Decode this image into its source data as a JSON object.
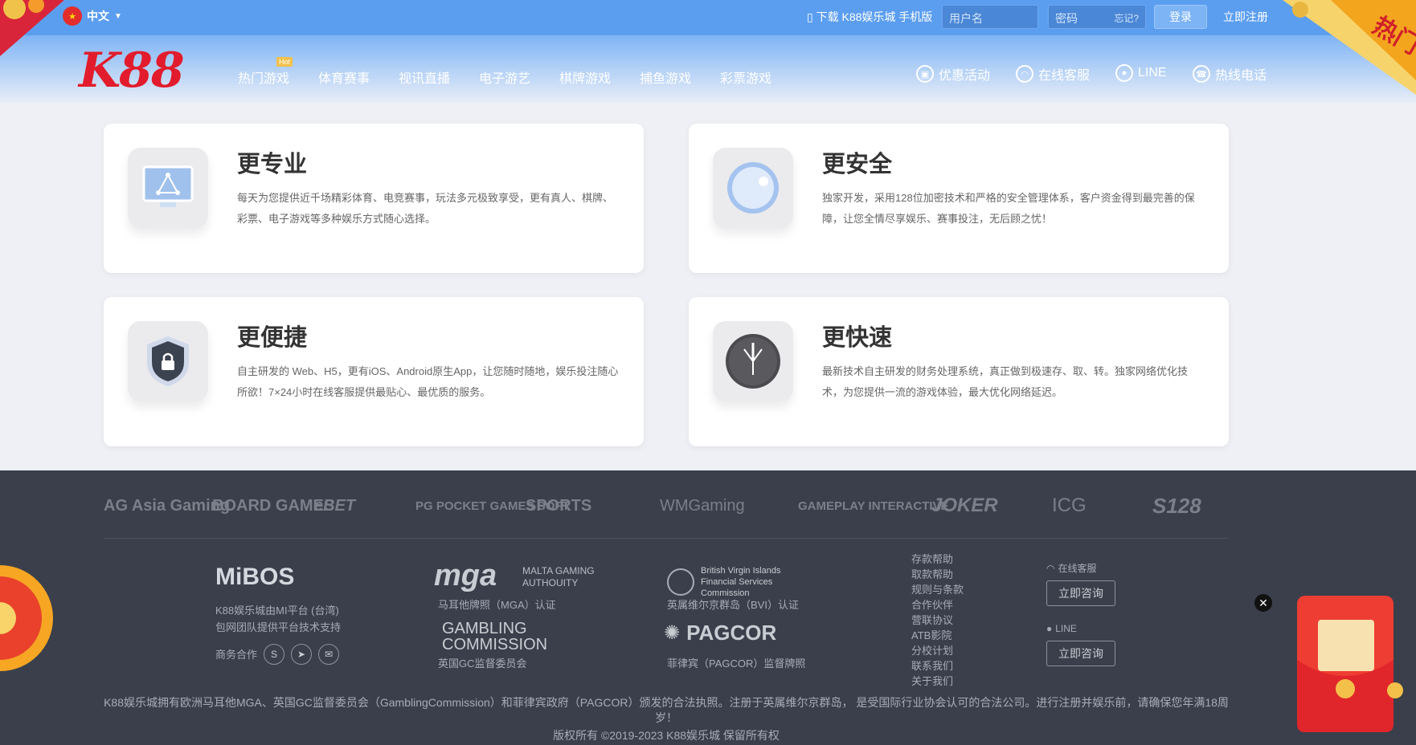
{
  "topbar": {
    "lang": "中文",
    "download_text": "下载 K88娱乐城 手机版",
    "username_placeholder": "用户名",
    "password_placeholder": "密码",
    "forgot_text": "忘记?",
    "login_label": "登录",
    "register_label": "立即注册"
  },
  "header": {
    "logo_text": "K88",
    "hot_badge": "Hot",
    "nav": [
      "热门游戏",
      "体育赛事",
      "视讯直播",
      "电子游艺",
      "棋牌游戏",
      "捕鱼游戏",
      "彩票游戏"
    ],
    "right_nav": [
      "优惠活动",
      "在线客服",
      "LINE",
      "热线电话"
    ]
  },
  "promo": {
    "corner_banner": "热门"
  },
  "features": [
    {
      "title": "更专业",
      "desc": "每天为您提供近千场精彩体育、电竞赛事，玩法多元极致享受，更有真人、棋牌、彩票、电子游戏等多种娱乐方式随心选择。",
      "icon": "monitor-icon"
    },
    {
      "title": "更安全",
      "desc": "独家开发，采用128位加密技术和严格的安全管理体系，客户资金得到最完善的保障，让您全情尽享娱乐、赛事投注，无后顾之忧！",
      "icon": "shield-orb-icon"
    },
    {
      "title": "更便捷",
      "desc": "自主研发的 Web、H5，更有iOS、Android原生App，让您随时随地，娱乐投注随心所欲！7×24小时在线客服提供最贴心、最优质的服务。",
      "icon": "lock-shield-icon"
    },
    {
      "title": "更快速",
      "desc": "最新技术自主研发的财务处理系统，真正做到极速存、取、转。独家网络优化技术，为您提供一流的游戏体验，最大优化网络延迟。",
      "icon": "clock-icon"
    }
  ],
  "providers": [
    "AG Asia Gaming",
    "BOARD GAMES",
    "eBET",
    "PG POCKET GAMES SOFT",
    "SPORTS",
    "WMGaming",
    "GAMEPLAY INTERACTIVE",
    "JOKER",
    "ICG",
    "S128"
  ],
  "footer": {
    "mibos_logo": "MiBOS",
    "mibos_text": [
      "K88娱乐城由MI平台 (台湾)",
      "包网团队提供平台技术支持"
    ],
    "business_label": "商务合作",
    "mga_logo": "mga",
    "mga_sub": "MALTA GAMING AUTHOUITY",
    "mga_cert": "马耳他牌照（MGA）认证",
    "gc_logo": "GAMBLING COMMISSION",
    "gc_cert": "英国GC监督委员会",
    "bvi_logo": "British Virgin Islands Financial Services Commission",
    "bvi_cert": "英属维尔京群岛（BVI）认证",
    "pagcor_logo": "PAGCOR",
    "pagcor_cert": "菲律宾（PAGCOR）监督牌照",
    "links": [
      "存款帮助",
      "取款帮助",
      "规则与条款",
      "合作伙伴",
      "营联协议",
      "ATB影院",
      "分校计划",
      "联系我们",
      "关于我们"
    ],
    "online_service": "在线客服",
    "consult_label": "立即咨询",
    "line_label": "LINE",
    "consult_label_2": "立即咨询",
    "disclaimer": "K88娱乐城拥有欧洲马耳他MGA、英国GC监督委员会（GamblingCommission）和菲律宾政府（PAGCOR）颁发的合法执照。注册于英属维尔京群岛， 是受国际行业协会认可的合法公司。进行注册并娱乐前，请确保您年满18周岁！",
    "copyright": "版权所有 ©2019-2023 K88娱乐城 保留所有权"
  },
  "colors": {
    "topbar": "#5b9ef0",
    "footer": "#3a3f4b",
    "logo": "#e21c2c",
    "accent": "#f3c04a"
  }
}
